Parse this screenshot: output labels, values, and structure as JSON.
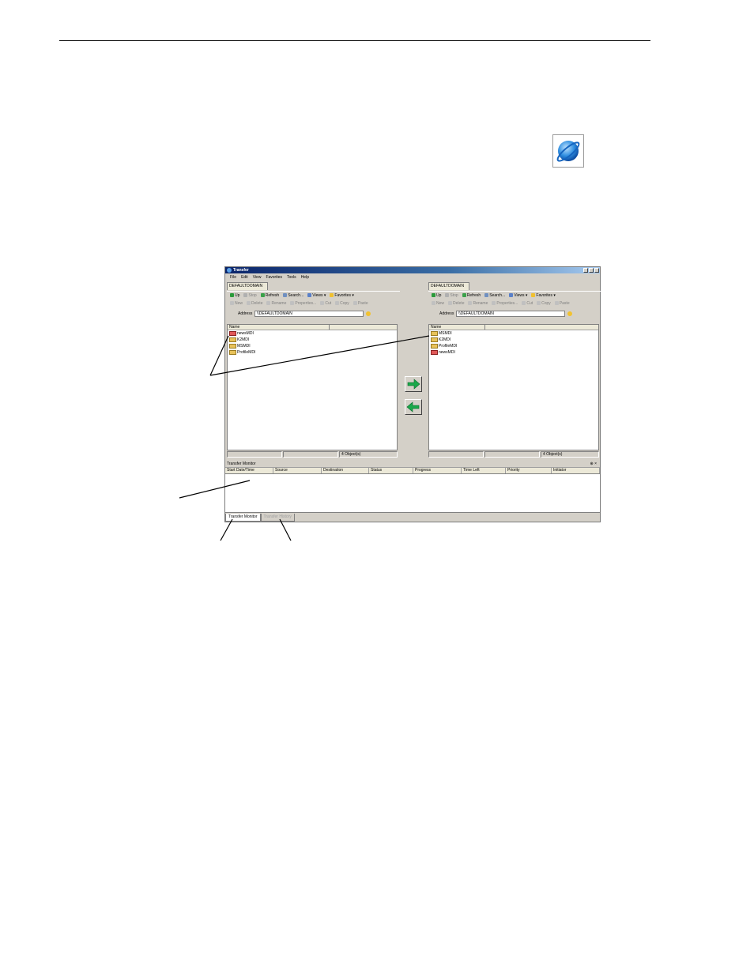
{
  "window": {
    "title": "Transfer",
    "menu": [
      "File",
      "Edit",
      "View",
      "Favorites",
      "Tools",
      "Help"
    ]
  },
  "left_pane": {
    "tab": "DEFAULTDOMAIN",
    "toolbar1": [
      "Up",
      "Stop",
      "Refresh",
      "Search...",
      "Views",
      "Favorites"
    ],
    "toolbar2": [
      "New",
      "Delete",
      "Rename",
      "Properties...",
      "Cut",
      "Copy",
      "Paste"
    ],
    "address_label": "Address",
    "address_value": "\\\\DEFAULTDOMAIN",
    "list_header": "Name",
    "items": [
      "newsMDI",
      "K2MDI",
      "MSMDI",
      "ProfileMDI"
    ],
    "status": "4 Object(s)"
  },
  "right_pane": {
    "tab": "DEFAULTDOMAIN",
    "toolbar1": [
      "Up",
      "Stop",
      "Refresh",
      "Search...",
      "Views",
      "Favorites"
    ],
    "toolbar2": [
      "New",
      "Delete",
      "Rename",
      "Properties...",
      "Cut",
      "Copy",
      "Paste"
    ],
    "address_label": "Address",
    "address_value": "\\\\DEFAULTDOMAIN",
    "list_header": "Name",
    "items": [
      "MSMDI",
      "K2MDI",
      "ProfileMDI",
      "newsMDI"
    ],
    "status": "4 Object(s)"
  },
  "monitor": {
    "title": "Transfer Monitor",
    "columns": [
      "Start Date/Time",
      "Source",
      "Destination",
      "Status",
      "Progress",
      "Time Left",
      "Priority",
      "Initiator"
    ]
  },
  "bottom_tabs": [
    "Transfer Monitor",
    "Transfer History"
  ],
  "colors": {
    "titlebar": "#0a246a",
    "transfer_arrow": "#1aa84a",
    "window_bg": "#d4d0c8"
  },
  "icons": {
    "app": "planet-icon",
    "transfer_right": "arrow-right-icon",
    "transfer_left": "arrow-left-icon"
  }
}
